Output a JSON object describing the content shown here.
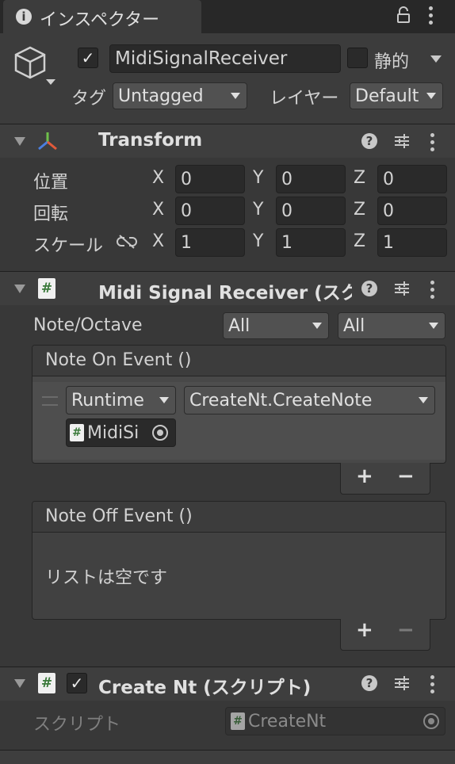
{
  "tab": {
    "title": "インスペクター"
  },
  "object": {
    "active": true,
    "name": "MidiSignalReceiver",
    "static_label": "静的",
    "static": false,
    "tag_label": "タグ",
    "tag_value": "Untagged",
    "layer_label": "レイヤー",
    "layer_value": "Default"
  },
  "transform": {
    "title": "Transform",
    "rows": [
      {
        "label": "位置",
        "x": "0",
        "y": "0",
        "z": "0"
      },
      {
        "label": "回転",
        "x": "0",
        "y": "0",
        "z": "0"
      },
      {
        "label": "スケール",
        "x": "1",
        "y": "1",
        "z": "1"
      }
    ],
    "axis": {
      "x": "X",
      "y": "Y",
      "z": "Z"
    }
  },
  "midi": {
    "title": "Midi Signal Receiver (スク",
    "note_label": "Note/Octave",
    "note_value": "All",
    "octave_value": "All",
    "note_on": {
      "title": "Note On Event ()",
      "runtime": "Runtime",
      "function": "CreateNt.CreateNote",
      "object": "MidiSi"
    },
    "note_off": {
      "title": "Note Off Event ()",
      "empty": "リストは空です"
    },
    "plus": "+",
    "minus": "−"
  },
  "create_nt": {
    "title": "Create Nt (スクリプト)",
    "script_label": "スクリプト",
    "script_value": "CreateNt"
  },
  "icons": {
    "hash": "#",
    "help": "?",
    "check": "✓"
  }
}
